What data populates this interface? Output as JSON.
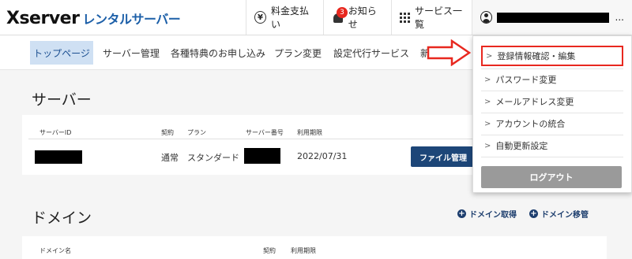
{
  "header": {
    "logo_main": "Xserver",
    "logo_sub": "レンタルサーバー",
    "pay_label": "料金支払い",
    "news_label": "お知らせ",
    "news_badge": "3",
    "services_label": "サービス一覧",
    "user_ellipsis": "..."
  },
  "nav": {
    "items": [
      {
        "label": "トップページ",
        "active": true
      },
      {
        "label": "サーバー管理"
      },
      {
        "label": "各種特典のお申し込み"
      },
      {
        "label": "プラン変更"
      },
      {
        "label": "設定代行サービス"
      },
      {
        "label": "新"
      }
    ]
  },
  "server": {
    "heading": "サーバー",
    "columns": [
      "サーバーID",
      "契約",
      "プラン",
      "サーバー番号",
      "利用期限"
    ],
    "row": {
      "contract": "通常",
      "plan": "スタンダード",
      "expiry": "2022/07/31",
      "file_button": "ファイル管理"
    }
  },
  "domain": {
    "heading": "ドメイン",
    "acquire_label": "ドメイン取得",
    "transfer_label": "ドメイン移管",
    "columns": [
      "ドメイン名",
      "契約",
      "利用期限"
    ]
  },
  "account_menu": {
    "items": [
      {
        "label": "登録情報確認・編集",
        "highlighted": true
      },
      {
        "label": "パスワード変更"
      },
      {
        "label": "メールアドレス変更"
      },
      {
        "label": "アカウントの統合"
      },
      {
        "label": "自動更新設定"
      }
    ],
    "logout_label": "ログアウト"
  },
  "colors": {
    "brand_blue": "#1c5fa8",
    "nav_active_bg": "#cfe0f3",
    "button_navy": "#1d4678",
    "highlight_red": "#e8281f",
    "logout_gray": "#9a9a9a"
  }
}
